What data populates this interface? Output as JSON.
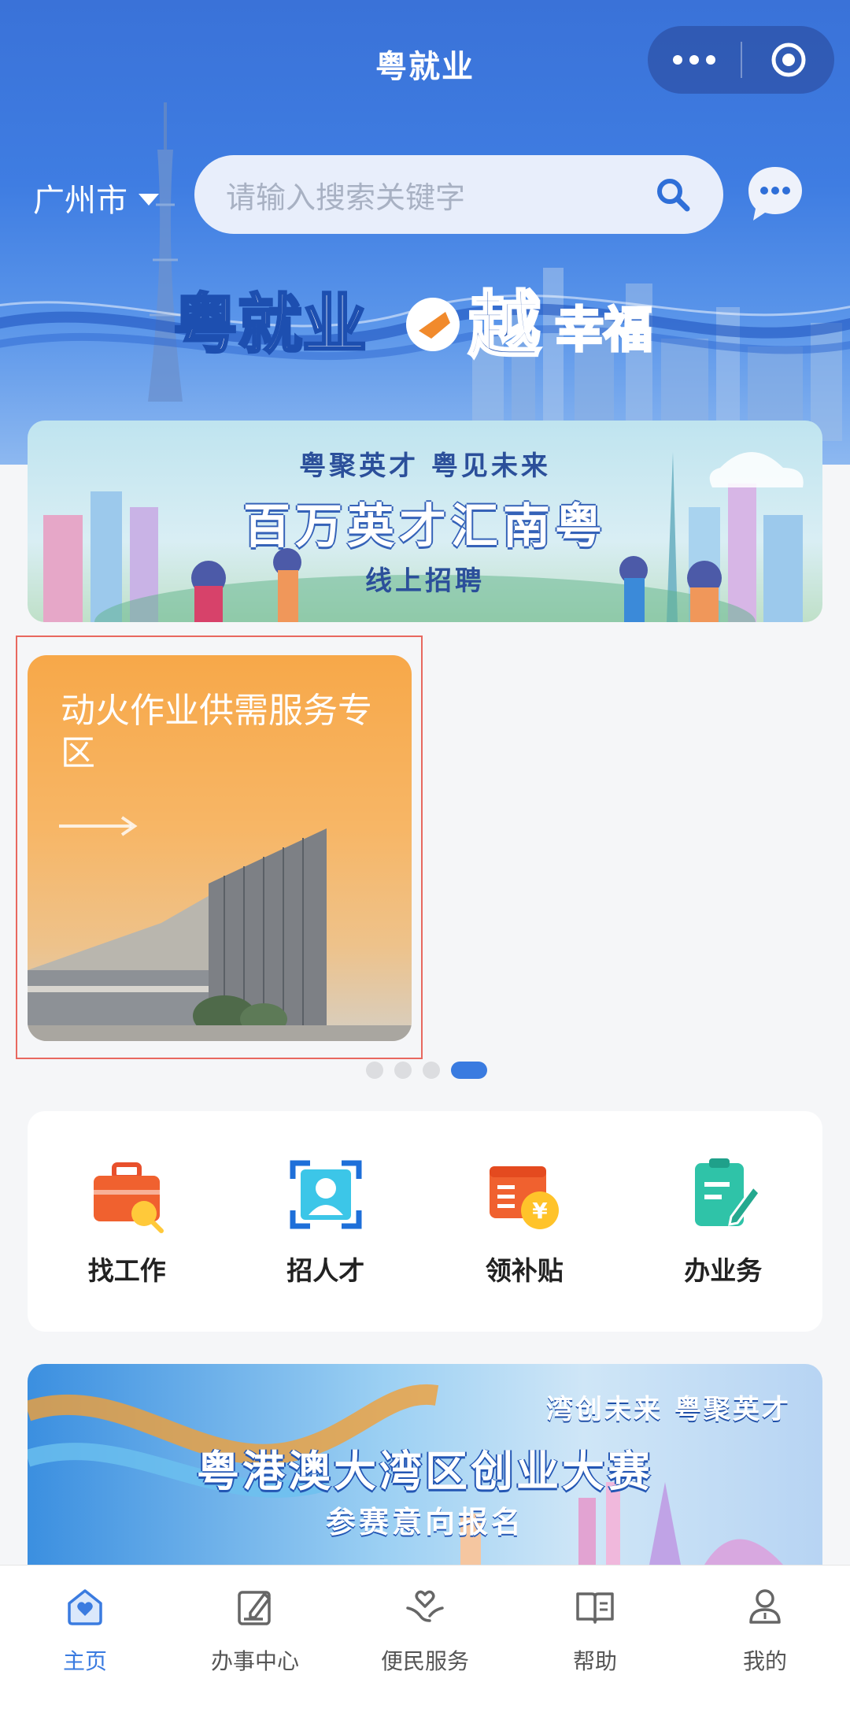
{
  "app": {
    "title": "粤就业"
  },
  "capsule": {
    "menu_icon": "more-dots-icon",
    "close_icon": "target-circle-icon"
  },
  "header": {
    "city": "广州市",
    "search_placeholder": "请输入搜索关键字",
    "search_icon": "search-icon",
    "chat_icon": "chat-bubble-icon",
    "logo_text": [
      "粤就业",
      "越",
      "幸福"
    ]
  },
  "banner1": {
    "subtitle": "粤聚英才 粤见未来",
    "title": "百万英才汇南粤",
    "line": "线上招聘"
  },
  "promo_card": {
    "title": "动火作业供需服务专区"
  },
  "pager": {
    "count": 4,
    "active_index": 3
  },
  "actions": [
    {
      "label": "找工作",
      "icon": "briefcase-icon"
    },
    {
      "label": "招人才",
      "icon": "person-scan-icon"
    },
    {
      "label": "领补贴",
      "icon": "subsidy-coin-icon"
    },
    {
      "label": "办业务",
      "icon": "document-edit-icon"
    }
  ],
  "banner2": {
    "subtitle": "湾创未来 粤聚英才",
    "title": "粤港澳大湾区创业大赛",
    "line": "参赛意向报名"
  },
  "tabs": [
    {
      "label": "主页",
      "icon": "home-heart-icon",
      "active": true
    },
    {
      "label": "办事中心",
      "icon": "edit-square-icon",
      "active": false
    },
    {
      "label": "便民服务",
      "icon": "heart-hands-icon",
      "active": false
    },
    {
      "label": "帮助",
      "icon": "open-book-icon",
      "active": false
    },
    {
      "label": "我的",
      "icon": "user-icon",
      "active": false
    }
  ],
  "colors": {
    "primary": "#3a7be0",
    "hero": "#3f7de2",
    "card_orange": "#f7a849"
  }
}
